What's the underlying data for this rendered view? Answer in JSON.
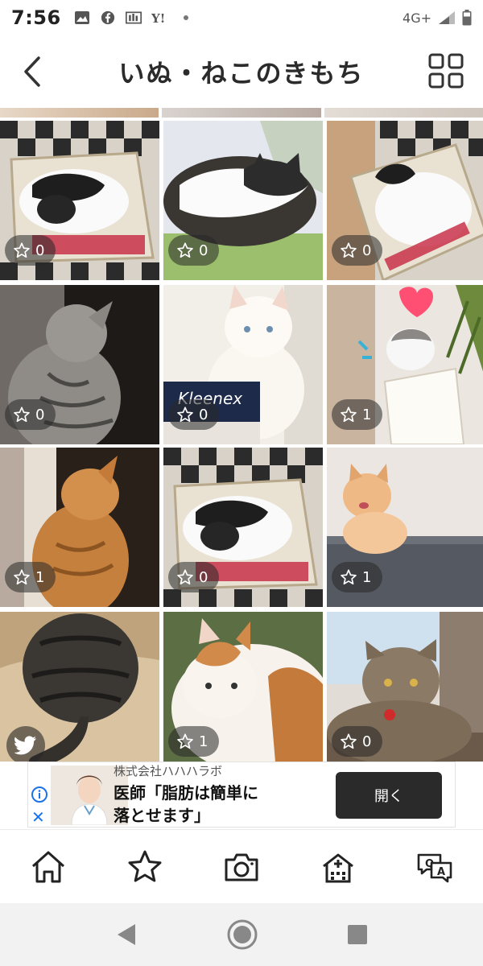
{
  "status_bar": {
    "time": "7:56",
    "network": "4G+"
  },
  "header": {
    "title": "いぬ・ねこのきもち"
  },
  "photos": [
    {
      "likes": "0",
      "scene": "box"
    },
    {
      "likes": "0",
      "scene": "sleep"
    },
    {
      "likes": "0",
      "scene": "box2"
    },
    {
      "likes": "0",
      "scene": "grey"
    },
    {
      "likes": "0",
      "scene": "white"
    },
    {
      "likes": "1",
      "scene": "pot"
    },
    {
      "likes": "1",
      "scene": "orange"
    },
    {
      "likes": "0",
      "scene": "box"
    },
    {
      "likes": "1",
      "scene": "ginger"
    },
    {
      "likes": "",
      "scene": "back",
      "twitter": true
    },
    {
      "likes": "1",
      "scene": "calico"
    },
    {
      "likes": "0",
      "scene": "tabby"
    }
  ],
  "ad": {
    "company": "株式会社ハハハラボ",
    "headline_line1": "医師「脂肪は簡単に",
    "headline_line2": "落とせます」",
    "cta": "開く"
  },
  "icons": {
    "back": "chevron-left-icon",
    "grid": "grid-view-icon",
    "tabs": [
      "home-icon",
      "star-icon",
      "camera-icon",
      "hospital-icon",
      "qa-icon"
    ],
    "nav": [
      "nav-back-icon",
      "nav-home-icon",
      "nav-recents-icon"
    ]
  },
  "colors": {
    "ad_button": "#2a2a2a",
    "badge_bg": "#383838"
  }
}
